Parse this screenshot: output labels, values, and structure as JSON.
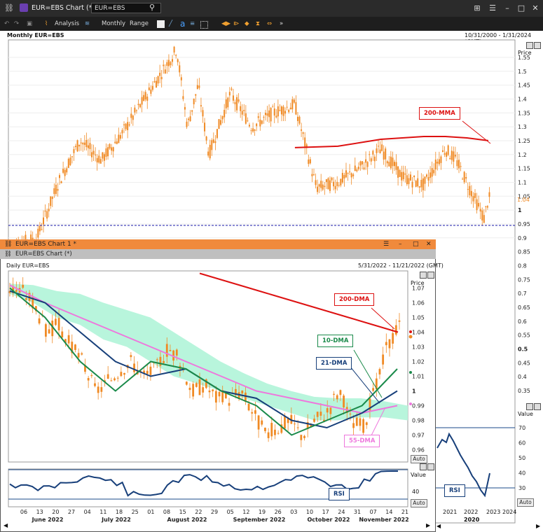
{
  "window": {
    "title": "EUR=EBS Chart (*)",
    "search_value": "EUR=EBS"
  },
  "toolbar": {
    "analysis": "Analysis",
    "interval": "Monthly",
    "range": "Range"
  },
  "main_chart": {
    "title": "Monthly EUR=EBS",
    "date_range": "10/31/2000 - 1/31/2024 (GMT)",
    "axis_title": "Price",
    "ma_label": "200-MMA",
    "price_ticks": [
      "1.55",
      "1.5",
      "1.45",
      "1.4",
      "1.35",
      "1.3",
      "1.25",
      "1.2",
      "1.15",
      "1.1",
      "1.05",
      "1",
      "0.95",
      "0.9",
      "0.85",
      "0.8",
      "0.75",
      "0.7",
      "0.65",
      "0.6",
      "0.55",
      "0.5",
      "0.45",
      "0.4",
      "0.35"
    ],
    "last_tick": "1.04",
    "rsi_axis_title": "Value",
    "rsi_ticks": [
      "70",
      "60",
      "50",
      "40",
      "30"
    ],
    "rsi_last": "40",
    "rsi_label": "RSI",
    "rsi_auto": "Auto",
    "year_labels": [
      "2021",
      "2022",
      "2023",
      "2024"
    ],
    "period_label": "2020"
  },
  "inner_window": {
    "title": "EUR=EBS Chart 1 *",
    "tab": "EUR=EBS Chart (*)",
    "chart_title": "Daily EUR=EBS",
    "date_range": "5/31/2022 - 11/21/2022 (GMT)",
    "axis_title": "Price",
    "price_ticks": [
      "1.07",
      "1.06",
      "1.05",
      "1.04",
      "1.03",
      "1.02",
      "1.01",
      "1",
      "0.99",
      "0.98",
      "0.97",
      "0.96"
    ],
    "labels": {
      "dma200": "200-DMA",
      "dma10": "10-DMA",
      "dma21": "21-DMA",
      "dma55": "55-DMA"
    },
    "auto": "Auto",
    "rsi_axis_title": "Value",
    "rsi_tick": "40",
    "rsi_label": "RSI",
    "rsi_auto": "Auto",
    "day_ticks": [
      "06",
      "13",
      "20",
      "27",
      "04",
      "11",
      "18",
      "25",
      "01",
      "08",
      "15",
      "22",
      "29",
      "05",
      "12",
      "19",
      "26",
      "03",
      "10",
      "17",
      "24",
      "31",
      "07",
      "14",
      "21"
    ],
    "months": [
      "June 2022",
      "July 2022",
      "August 2022",
      "September 2022",
      "October 2022",
      "November 2022"
    ]
  },
  "colors": {
    "candle": "#f08a24",
    "ma200": "#dd1111",
    "dma10": "#1a8a4a",
    "dma21": "#173f7a",
    "dma55": "#ee77dd",
    "cloud": "#b8f5dc",
    "rsi": "#173f7a"
  },
  "chart_data": [
    {
      "type": "line",
      "title": "Monthly EUR=EBS",
      "x_range": [
        "2000-10",
        "2024-01"
      ],
      "ylim": [
        0.35,
        1.6
      ],
      "series": [
        {
          "name": "EUR=EBS",
          "x": [
            2000.8,
            2002,
            2003,
            2004,
            2005,
            2006,
            2007,
            2008.5,
            2009,
            2009.5,
            2010,
            2011,
            2012,
            2013,
            2014,
            2015,
            2016,
            2017,
            2018,
            2019,
            2020,
            2021,
            2021.5,
            2022,
            2022.8,
            2023
          ],
          "values": [
            0.87,
            0.9,
            1.1,
            1.25,
            1.18,
            1.28,
            1.4,
            1.58,
            1.3,
            1.45,
            1.2,
            1.42,
            1.3,
            1.35,
            1.38,
            1.08,
            1.1,
            1.15,
            1.22,
            1.12,
            1.09,
            1.22,
            1.18,
            1.1,
            0.97,
            1.04
          ]
        },
        {
          "name": "200-MMA",
          "x": [
            2014,
            2016,
            2018,
            2020,
            2021,
            2022,
            2023
          ],
          "values": [
            1.225,
            1.23,
            1.255,
            1.265,
            1.265,
            1.26,
            1.25
          ]
        }
      ]
    },
    {
      "type": "line",
      "title": "Daily EUR=EBS",
      "x_range": [
        "2022-05-31",
        "2022-11-21"
      ],
      "ylim": [
        0.95,
        1.08
      ],
      "series": [
        {
          "name": "200-DMA",
          "values": [
            1.08,
            1.075,
            1.07,
            1.065,
            1.06,
            1.055,
            1.05,
            1.045,
            1.04
          ]
        },
        {
          "name": "10-DMA",
          "values": [
            1.07,
            1.05,
            1.02,
            1.0,
            1.02,
            1.015,
            1.0,
            0.99,
            0.97,
            0.98,
            0.99,
            1.015
          ]
        },
        {
          "name": "21-DMA",
          "values": [
            1.068,
            1.06,
            1.04,
            1.02,
            1.01,
            1.015,
            1.0,
            0.995,
            0.98,
            0.975,
            0.985,
            1.0
          ]
        },
        {
          "name": "55-DMA",
          "values": [
            1.072,
            1.06,
            1.05,
            1.04,
            1.03,
            1.02,
            1.01,
            1.0,
            0.995,
            0.99,
            0.985,
            0.99
          ]
        }
      ]
    }
  ]
}
